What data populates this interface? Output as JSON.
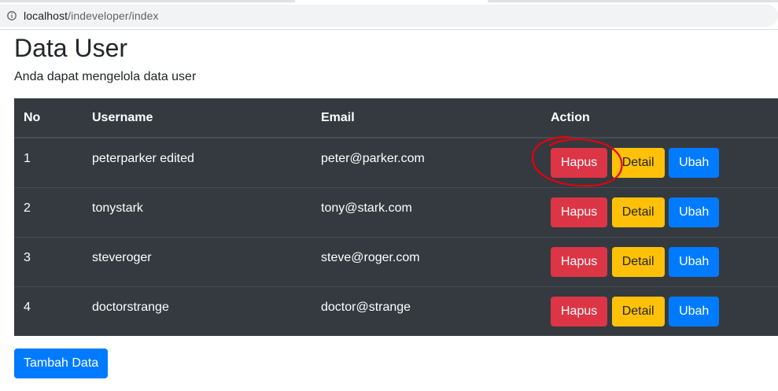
{
  "browser": {
    "url_host": "localhost",
    "url_path": "/indeveloper/index",
    "info_icon": "info-circle-icon"
  },
  "page": {
    "title": "Data User",
    "subtitle": "Anda dapat mengelola data user"
  },
  "table": {
    "headers": {
      "no": "No",
      "username": "Username",
      "email": "Email",
      "action": "Action"
    },
    "rows": [
      {
        "no": "1",
        "username": "peterparker edited",
        "email": "peter@parker.com"
      },
      {
        "no": "2",
        "username": "tonystark",
        "email": "tony@stark.com"
      },
      {
        "no": "3",
        "username": "steveroger",
        "email": "steve@roger.com"
      },
      {
        "no": "4",
        "username": "doctorstrange",
        "email": "doctor@strange"
      }
    ],
    "actions": {
      "delete_label": "Hapus",
      "detail_label": "Detail",
      "edit_label": "Ubah"
    }
  },
  "footer": {
    "add_label": "Tambah Data"
  },
  "colors": {
    "table_bg": "#343a40",
    "danger": "#dc3545",
    "warning": "#ffc107",
    "primary": "#007bff",
    "annotation": "#e8000b"
  }
}
